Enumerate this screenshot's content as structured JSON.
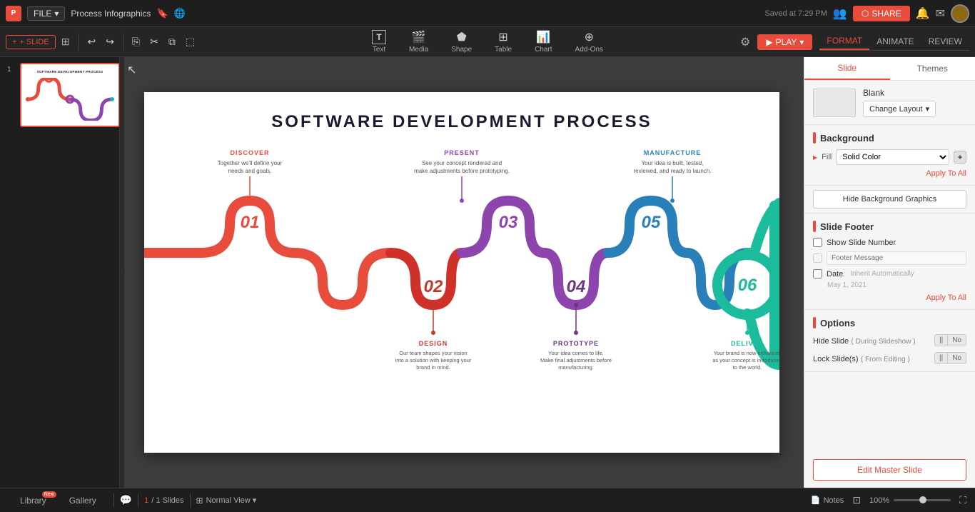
{
  "app": {
    "icon": "P",
    "file_label": "FILE",
    "doc_title": "Process Infographics",
    "saved_text": "Saved at 7:29 PM"
  },
  "toolbar": {
    "add_slide": "+ SLIDE",
    "undo": "↩",
    "redo": "↪",
    "copy_format": "⎘",
    "cut": "✂",
    "copy": "⧉",
    "paste": "⬚"
  },
  "tools": [
    {
      "id": "text",
      "icon": "T",
      "label": "Text"
    },
    {
      "id": "media",
      "icon": "🖼",
      "label": "Media"
    },
    {
      "id": "shape",
      "icon": "⬟",
      "label": "Shape"
    },
    {
      "id": "table",
      "icon": "⊞",
      "label": "Table"
    },
    {
      "id": "chart",
      "icon": "📊",
      "label": "Chart"
    },
    {
      "id": "addons",
      "icon": "⊕",
      "label": "Add-Ons"
    }
  ],
  "right_toolbar": {
    "play_label": "▶ PLAY",
    "mode_tabs": [
      "FORMAT",
      "ANIMATE",
      "REVIEW"
    ]
  },
  "slide": {
    "title": "SOFTWARE DEVELOPMENT PROCESS",
    "steps": [
      {
        "num": "01",
        "top_label": "DISCOVER",
        "top_desc": "Together we'll define your needs and goals.",
        "top_label_color": "#e84c3d",
        "color": "#e84c3d"
      },
      {
        "num": "02",
        "color": "#c0392b",
        "label_color": "#c0392b"
      },
      {
        "num": "03",
        "top_label": "PRESENT",
        "top_desc": "See your concept rendered and make adjustments before prototyping.",
        "top_label_color": "#8e44ad",
        "color": "#8e44ad"
      },
      {
        "num": "04",
        "color": "#6c3483",
        "label_color": "#6c3483"
      },
      {
        "num": "05",
        "top_label": "MANUFACTURE",
        "top_desc": "Your idea is built, tested, reviewed, and ready to launch.",
        "top_label_color": "#2980b9",
        "color": "#2980b9"
      },
      {
        "num": "06",
        "color": "#1abc9c",
        "label_color": "#1abc9c"
      }
    ],
    "bottom_steps": [
      {
        "label": "DESIGN",
        "desc": "Our team shapes your vision into a solution with keeping your brand in mind.",
        "color": "#c0392b"
      },
      {
        "label": "PROTOTYPE",
        "desc": "Your idea comes to life. Make final adjustments before manufacturing.",
        "color": "#6c3483"
      },
      {
        "label": "DELIVER",
        "desc": "Your brand is now enhanced as your concept is introduced to the world.",
        "color": "#1abc9c"
      }
    ]
  },
  "right_panel": {
    "tabs": [
      "Slide",
      "Themes"
    ],
    "active_tab": "Slide",
    "layout": {
      "name": "Blank",
      "change_label": "Change Layout"
    },
    "background": {
      "title": "Background",
      "fill_label": "Fill",
      "fill_option": "Solid Color",
      "apply_all": "Apply To All",
      "hide_bg_btn": "Hide Background Graphics"
    },
    "footer": {
      "title": "Slide Footer",
      "show_slide_number": "Show Slide Number",
      "footer_message": "Footer Message",
      "date": "Date",
      "inherit_auto": "Inherit Automatically",
      "date_value": "May 1, 2021",
      "apply_all": "Apply To All"
    },
    "options": {
      "title": "Options",
      "hide_slide_label": "Hide Slide",
      "hide_slide_sub": "( During Slideshow )",
      "lock_slides_label": "Lock Slide(s)",
      "lock_slides_sub": "( From Editing )",
      "no": "No",
      "ii": "||"
    },
    "edit_master": "Edit Master Slide"
  },
  "bottom_bar": {
    "chat_icon": "💬",
    "slide_num": "1",
    "slide_total": "1 Slides",
    "view_icon": "⊞",
    "view_label": "Normal View",
    "notes_icon": "📄",
    "notes_label": "Notes",
    "zoom_level": "100%",
    "fullscreen_icon": "⛶"
  },
  "bottom_tabs": [
    {
      "id": "library",
      "label": "Library",
      "badge": "New"
    },
    {
      "id": "gallery",
      "label": "Gallery"
    }
  ]
}
